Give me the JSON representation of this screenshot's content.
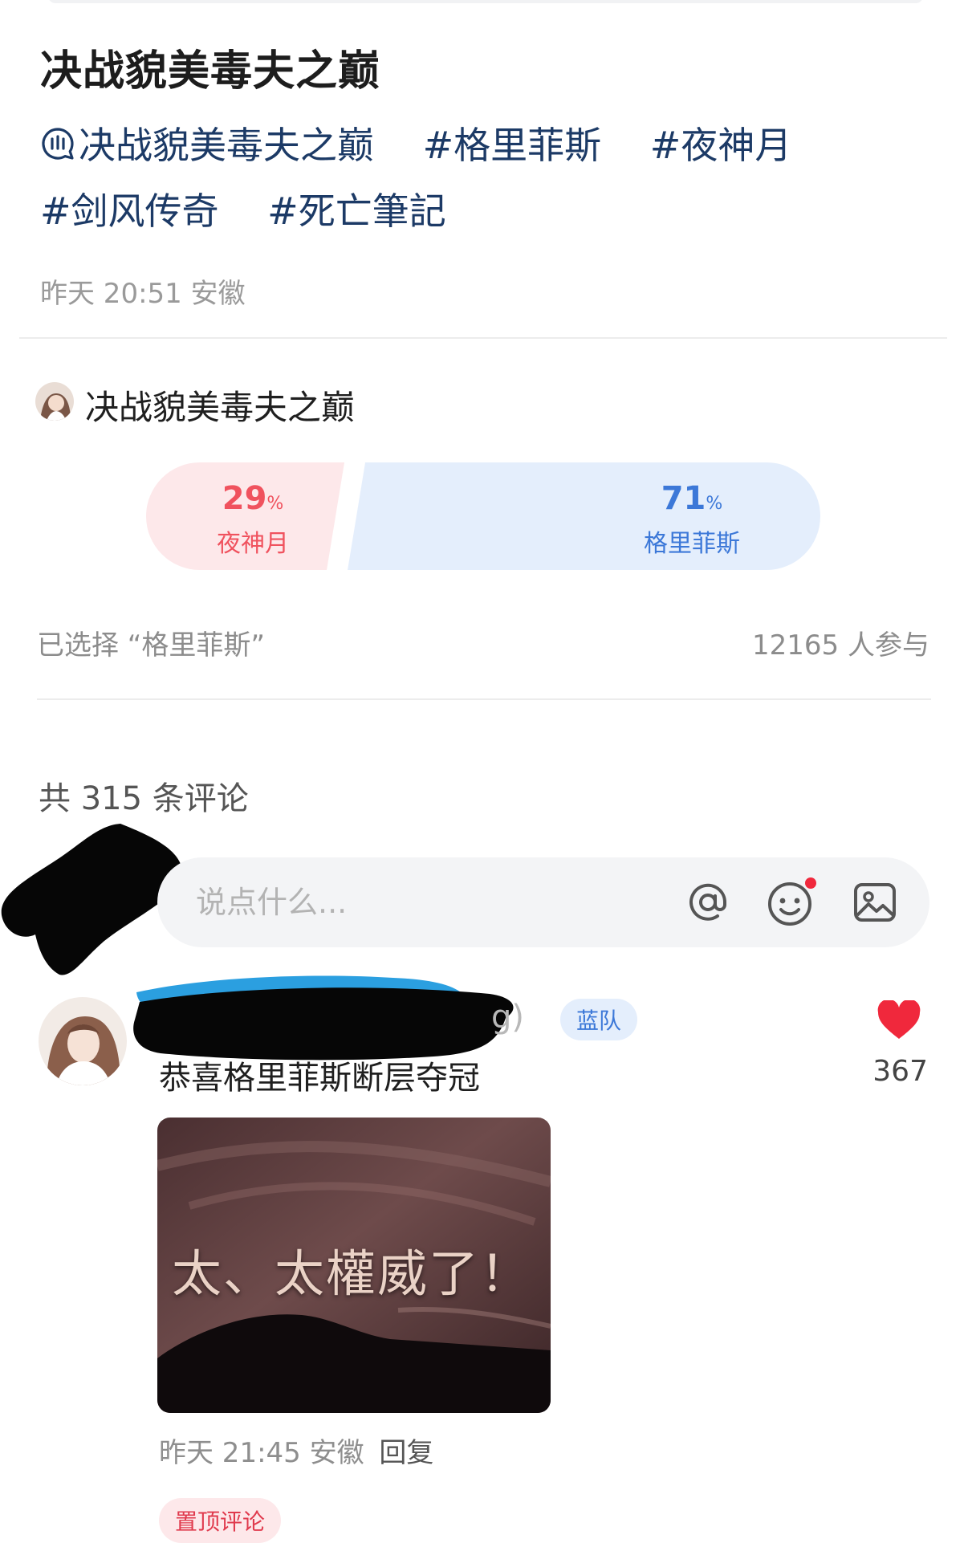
{
  "post": {
    "title": "决战貌美毒夫之巅",
    "topic_icon": "topic-bubble-icon",
    "tags": [
      "决战貌美毒夫之巅",
      "#格里菲斯",
      "#夜神月",
      "#剑风传奇",
      "#死亡筆記"
    ],
    "time": "昨天 20:51",
    "location": "安徽"
  },
  "poll": {
    "title": "决战貌美毒夫之巅",
    "options": [
      {
        "percent": "29",
        "pct_sign": "%",
        "name": "夜神月",
        "share": 0.29,
        "color": "#f0525e",
        "bg": "#fde8ea"
      },
      {
        "percent": "71",
        "pct_sign": "%",
        "name": "格里菲斯",
        "share": 0.71,
        "color": "#3c78d8",
        "bg": "#e4eefc"
      }
    ],
    "selected_text": "已选择 “格里菲斯”",
    "participants": "12165 人参与"
  },
  "comments": {
    "count_heading": "共 315 条评论",
    "input_placeholder": "说点什么...",
    "input_icons": [
      "at-icon",
      "emoji-icon",
      "image-icon"
    ],
    "items": [
      {
        "username_visible_tail": "g)",
        "badge": "蓝队",
        "text": "恭喜格里菲斯断层夺冠",
        "likes": "367",
        "image_caption": "太、太權威了！",
        "time": "昨天 21:45",
        "location": "安徽",
        "reply_label": "回复"
      }
    ],
    "pinned_label": "置顶评论"
  }
}
